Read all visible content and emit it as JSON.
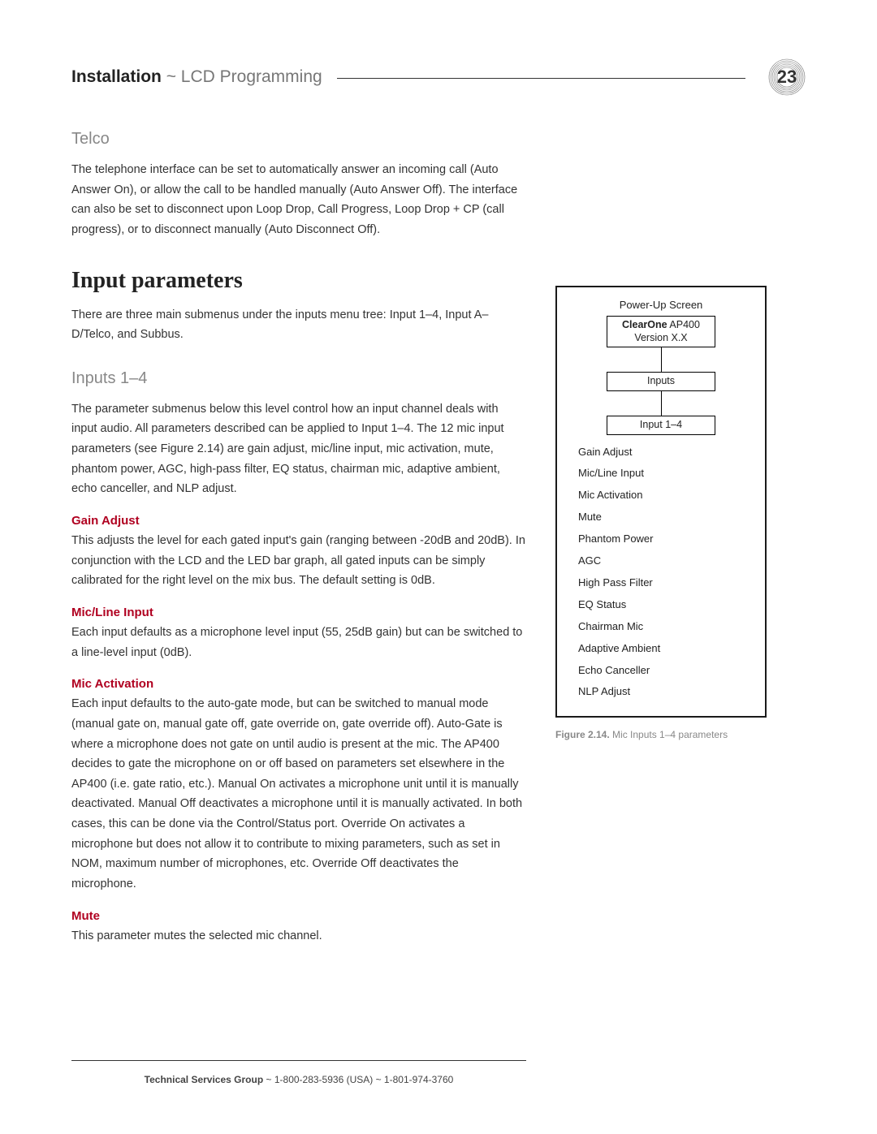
{
  "header": {
    "strong": "Installation",
    "sep": " ~ ",
    "light": "LCD Programming",
    "page_number": "23"
  },
  "main": {
    "telco_heading": "Telco",
    "telco_para": "The telephone interface can be set to automatically answer an incoming call (Auto Answer On), or allow the call to be handled manually (Auto Answer Off). The interface can also be set to disconnect upon Loop Drop, Call Progress, Loop Drop + CP (call progress), or to disconnect manually (Auto Disconnect Off).",
    "input_params_heading": "Input parameters",
    "input_params_intro": "There are three main submenus under the inputs menu tree: Input 1–4, Input A–D/Telco, and Subbus.",
    "inputs14_heading": "Inputs 1–4",
    "inputs14_intro": "The parameter submenus below this level control how an input channel deals with input audio. All parameters described can be applied to Input 1–4. The 12 mic input parameters (see Figure 2.14) are gain adjust, mic/line input, mic activation, mute, phantom power, AGC, high-pass filter, EQ status, chairman mic, adaptive ambient, echo canceller, and NLP adjust.",
    "params": [
      {
        "title": "Gain Adjust",
        "body": "This adjusts the level for each gated input's gain (ranging between -20dB and 20dB). In conjunction with the LCD and the LED bar graph, all gated inputs can be simply calibrated for the right level on the mix bus. The default setting is 0dB."
      },
      {
        "title": "Mic/Line Input",
        "body": "Each input defaults as a microphone level input (55, 25dB gain) but can be switched to a line-level input (0dB)."
      },
      {
        "title": "Mic Activation",
        "body": "Each input defaults to the auto-gate mode, but can be switched to manual mode (manual gate on, manual gate off, gate override on, gate override off). Auto-Gate is where a microphone does not gate on until audio is present at the mic. The AP400 decides to gate the microphone on or off based on parameters set elsewhere in the AP400 (i.e. gate ratio, etc.). Manual On activates a microphone unit until it is manually deactivated. Manual Off deactivates a microphone until it is manually activated. In both cases, this can be done via the Control/Status port. Override On activates a microphone but does not allow it to contribute to mixing parameters, such as set in NOM, maximum number of microphones, etc. Override Off deactivates the microphone."
      },
      {
        "title": "Mute",
        "body": "This parameter mutes the selected mic channel."
      }
    ]
  },
  "figure": {
    "power_up": "Power-Up Screen",
    "node1_bold": "ClearOne",
    "node1_rest": " AP400",
    "node1_line2": "Version X.X",
    "node2": "Inputs",
    "node3": "Input 1–4",
    "bullets": [
      "Gain Adjust",
      "Mic/Line Input",
      "Mic Activation",
      "Mute",
      "Phantom Power",
      "AGC",
      "High Pass Filter",
      "EQ Status",
      "Chairman Mic",
      "Adaptive Ambient",
      "Echo Canceller",
      "NLP Adjust"
    ],
    "caption_bold": "Figure 2.14.",
    "caption_rest": "  Mic Inputs 1–4 parameters"
  },
  "footer": {
    "bold": "Technical Services Group",
    "rest": " ~ 1-800-283-5936 (USA) ~ 1-801-974-3760"
  }
}
